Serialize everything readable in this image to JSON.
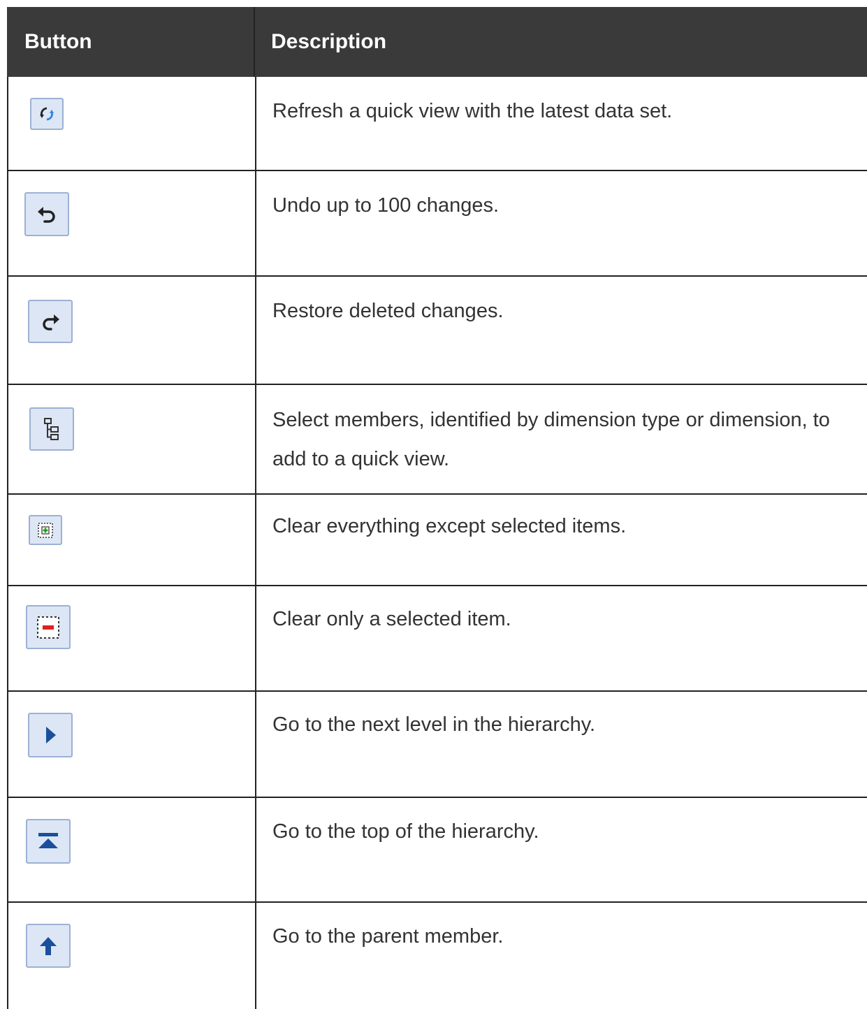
{
  "header": {
    "button": "Button",
    "description": "Description"
  },
  "rows": [
    {
      "icon": "refresh-icon",
      "text": "Refresh a quick view with the latest data set."
    },
    {
      "icon": "undo-icon",
      "text": "Undo up to 100 changes."
    },
    {
      "icon": "redo-icon",
      "text": "Restore deleted changes."
    },
    {
      "icon": "member-selector-icon",
      "text": "Select members, identified by dimension type or dimension, to add to a quick view."
    },
    {
      "icon": "keep-selected-icon",
      "text": "Clear everything except selected items."
    },
    {
      "icon": "remove-selected-icon",
      "text": "Clear only a selected item."
    },
    {
      "icon": "next-level-icon",
      "text": "Go to the next level in the hierarchy."
    },
    {
      "icon": "top-of-hierarchy-icon",
      "text": "Go to the top of the hierarchy."
    },
    {
      "icon": "parent-member-icon",
      "text": "Go to the parent member."
    }
  ],
  "colors": {
    "header_bg": "#3a3a3a",
    "button_bg": "#dde6f5",
    "button_border": "#9cb1d3",
    "icon_blue": "#1a4f9c"
  }
}
